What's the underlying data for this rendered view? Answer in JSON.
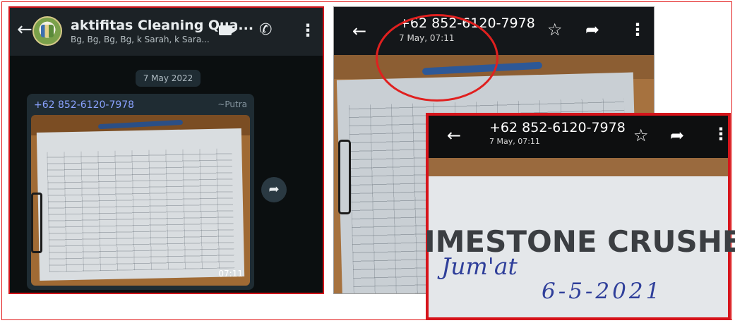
{
  "chat": {
    "title": "aktifitas Cleaning Qua...",
    "members": "Bg, Bg, Bg, Bg, k Sarah, k Sara...",
    "date_chip": "7 May 2022",
    "message": {
      "sender": "+62 852-6120-7978",
      "alias": "~Putra",
      "time": "07:11"
    }
  },
  "viewer": {
    "number": "+62 852-6120-7978",
    "date": "7 May, 07:11"
  },
  "inset": {
    "number": "+62 852-6120-7978",
    "date": "7 May, 07:11",
    "heading": "IMESTONE CRUSHER",
    "handwritten_day": "Jum'at",
    "handwritten_date": "6-5-2021"
  },
  "icons": {
    "back": "back-arrow-icon",
    "video": "video-call-icon",
    "call": "phone-icon",
    "more": "more-vertical-icon",
    "forward": "forward-icon",
    "star": "star-icon",
    "share": "share-icon"
  },
  "colors": {
    "highlight": "#e0201f",
    "whatsapp_dark": "#1f2c33",
    "sender_name": "#8aa2ff"
  }
}
